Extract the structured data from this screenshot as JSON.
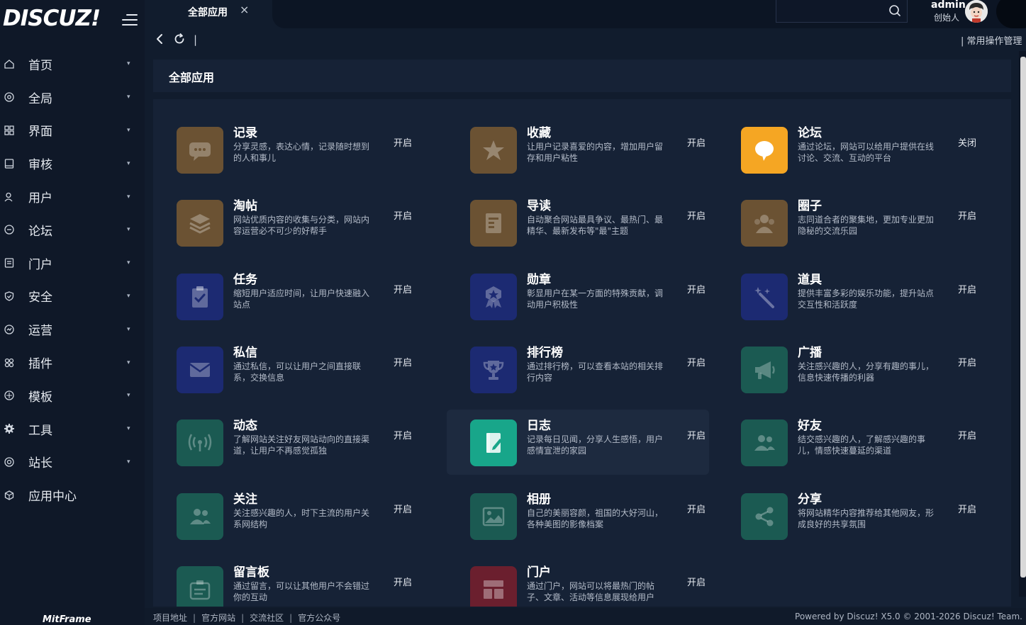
{
  "brand": {
    "logo": "DISCUZ!",
    "footer_brand": "MitFrame"
  },
  "sidebar": {
    "items": [
      {
        "label": "首页",
        "icon": "home-icon"
      },
      {
        "label": "全局",
        "icon": "globe-icon"
      },
      {
        "label": "界面",
        "icon": "layout-icon"
      },
      {
        "label": "审核",
        "icon": "audit-icon"
      },
      {
        "label": "用户",
        "icon": "user-icon"
      },
      {
        "label": "论坛",
        "icon": "forum-icon"
      },
      {
        "label": "门户",
        "icon": "portal-icon"
      },
      {
        "label": "安全",
        "icon": "shield-icon"
      },
      {
        "label": "运营",
        "icon": "operation-icon"
      },
      {
        "label": "插件",
        "icon": "plugin-icon"
      },
      {
        "label": "模板",
        "icon": "template-icon"
      },
      {
        "label": "工具",
        "icon": "gear-icon"
      },
      {
        "label": "站长",
        "icon": "webmaster-icon"
      },
      {
        "label": "应用中心",
        "icon": "app-center-icon"
      }
    ]
  },
  "topbar": {
    "tab_label": "全部应用",
    "tab_close": "×",
    "user_name": "admin",
    "user_role": "创始人"
  },
  "toolbar": {
    "divider": "|",
    "quick_ops": "| 常用操作管理"
  },
  "panel": {
    "title": "全部应用"
  },
  "colors": {
    "brown": "#6b5233",
    "orange": "#f5a623",
    "navy": "#1c2a72",
    "teal": "#1b5a52",
    "teal_active": "#18a68a",
    "red": "#6b1f2e"
  },
  "apps": [
    {
      "name": "记录",
      "desc": "分享灵感，表达心情，记录随时想到的人和事儿",
      "status": "开启",
      "icon": "chat-bubble-icon",
      "color": "#6b5233"
    },
    {
      "name": "收藏",
      "desc": "让用户记录喜爱的内容，增加用户留存和用户粘性",
      "status": "开启",
      "icon": "star-icon",
      "color": "#6b5233"
    },
    {
      "name": "论坛",
      "desc": "通过论坛，网站可以给用户提供在线讨论、交流、互动的平台",
      "status": "关闭",
      "icon": "speech-icon",
      "color": "#f5a623"
    },
    {
      "name": "淘帖",
      "desc": "网站优质内容的收集与分类，网站内容运营必不可少的好帮手",
      "status": "开启",
      "icon": "layers-icon",
      "color": "#6b5233"
    },
    {
      "name": "导读",
      "desc": "自动聚合网站最具争议、最热门、最精华、最新发布等\"最\"主题",
      "status": "开启",
      "icon": "document-icon",
      "color": "#6b5233"
    },
    {
      "name": "圈子",
      "desc": "志同道合者的聚集地，更加专业更加隐秘的交流乐园",
      "status": "开启",
      "icon": "group-icon",
      "color": "#6b5233"
    },
    {
      "name": "任务",
      "desc": "缩短用户适应时间，让用户快速融入站点",
      "status": "开启",
      "icon": "clipboard-check-icon",
      "color": "#1c2a72"
    },
    {
      "name": "勋章",
      "desc": "彰显用户在某一方面的特殊贡献，调动用户积极性",
      "status": "开启",
      "icon": "medal-icon",
      "color": "#1c2a72"
    },
    {
      "name": "道具",
      "desc": "提供丰富多彩的娱乐功能，提升站点交互性和活跃度",
      "status": "开启",
      "icon": "magic-wand-icon",
      "color": "#1c2a72"
    },
    {
      "name": "私信",
      "desc": "通过私信，可以让用户之间直接联系，交换信息",
      "status": "开启",
      "icon": "envelope-icon",
      "color": "#1c2a72"
    },
    {
      "name": "排行榜",
      "desc": "通过排行榜，可以查看本站的相关排行内容",
      "status": "开启",
      "icon": "trophy-icon",
      "color": "#1c2a72"
    },
    {
      "name": "广播",
      "desc": "关注感兴趣的人，分享有趣的事儿，信息快速传播的利器",
      "status": "开启",
      "icon": "megaphone-icon",
      "color": "#1b5a52"
    },
    {
      "name": "动态",
      "desc": "了解网站关注好友网站动向的直接渠道，让用户不再感觉孤独",
      "status": "开启",
      "icon": "broadcast-icon",
      "color": "#1b5a52"
    },
    {
      "name": "日志",
      "desc": "记录每日见闻，分享人生感悟，用户感情宣泄的家园",
      "status": "开启",
      "icon": "journal-icon",
      "color": "#18a68a"
    },
    {
      "name": "好友",
      "desc": "结交感兴趣的人，了解感兴趣的事儿，情感快速蔓延的渠道",
      "status": "开启",
      "icon": "friends-icon",
      "color": "#1b5a52"
    },
    {
      "name": "关注",
      "desc": "关注感兴趣的人，时下主流的用户关系网结构",
      "status": "开启",
      "icon": "follow-icon",
      "color": "#1b5a52"
    },
    {
      "name": "相册",
      "desc": "自己的美丽容颜，祖国的大好河山，各种美图的影像档案",
      "status": "开启",
      "icon": "image-icon",
      "color": "#1b5a52"
    },
    {
      "name": "分享",
      "desc": "将网站精华内容推荐给其他网友，形成良好的共享氛围",
      "status": "开启",
      "icon": "share-icon",
      "color": "#1b5a52"
    },
    {
      "name": "留言板",
      "desc": "通过留言，可以让其他用户不会错过你的互动",
      "status": "开启",
      "icon": "message-board-icon",
      "color": "#1b5a52"
    },
    {
      "name": "门户",
      "desc": "通过门户，网站可以将最热门的帖子、文章、活动等信息展现给用户",
      "status": "开启",
      "icon": "portal-grid-icon",
      "color": "#6b1f2e"
    }
  ],
  "footer": {
    "links": [
      "项目地址",
      "官方网站",
      "交流社区",
      "官方公众号"
    ],
    "separator": "|",
    "copyright": "Powered by Discuz! X5.0 © 2001-2026 Discuz! Team."
  }
}
